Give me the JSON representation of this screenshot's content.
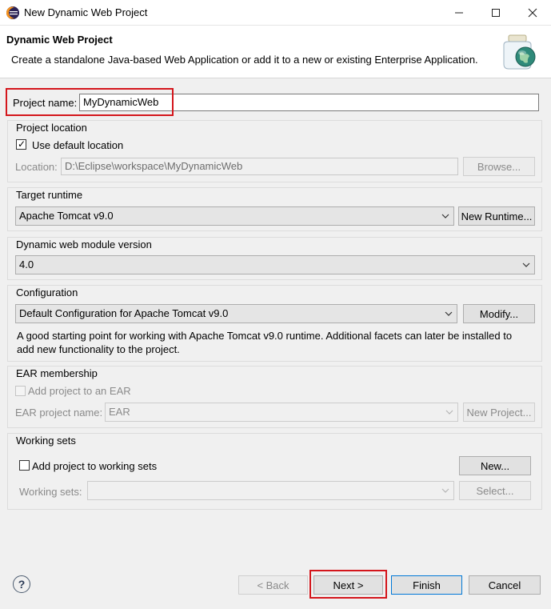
{
  "window": {
    "title": "New Dynamic Web Project",
    "minimize_glyph": "—",
    "maximize_glyph": "☐",
    "close_glyph": "✕"
  },
  "header": {
    "title": "Dynamic Web Project",
    "description": "Create a standalone Java-based Web Application or add it to a new or existing Enterprise Application."
  },
  "project_name": {
    "label": "Project name:",
    "value": "MyDynamicWeb"
  },
  "project_location": {
    "group_label": "Project location",
    "use_default_label": "Use default location",
    "use_default_checked": true,
    "location_label": "Location:",
    "location_value": "D:\\Eclipse\\workspace\\MyDynamicWeb",
    "browse_label": "Browse..."
  },
  "target_runtime": {
    "group_label": "Target runtime",
    "selected": "Apache Tomcat v9.0",
    "new_runtime_label": "New Runtime..."
  },
  "module_version": {
    "group_label": "Dynamic web module version",
    "selected": "4.0"
  },
  "configuration": {
    "group_label": "Configuration",
    "selected": "Default Configuration for Apache Tomcat v9.0",
    "modify_label": "Modify...",
    "description_line1": "A good starting point for working with Apache Tomcat v9.0 runtime. Additional facets can later be installed to",
    "description_line2": "add new functionality to the project."
  },
  "ear": {
    "group_label": "EAR membership",
    "add_label": "Add project to an EAR",
    "add_checked": false,
    "name_label": "EAR project name:",
    "name_value": "EAR",
    "new_project_label": "New Project..."
  },
  "working_sets": {
    "group_label": "Working sets",
    "add_label": "Add project to working sets",
    "add_checked": false,
    "new_label": "New...",
    "sets_label": "Working sets:",
    "select_label": "Select..."
  },
  "footer": {
    "help_glyph": "?",
    "back_label": "< Back",
    "next_label": "Next >",
    "finish_label": "Finish",
    "cancel_label": "Cancel"
  },
  "colors": {
    "highlight": "#d4161c",
    "accent": "#0078d7"
  },
  "icons": [
    "eclipse-icon",
    "jar-globe-icon",
    "checkmark-icon",
    "chevron-down-icon",
    "help-icon"
  ]
}
